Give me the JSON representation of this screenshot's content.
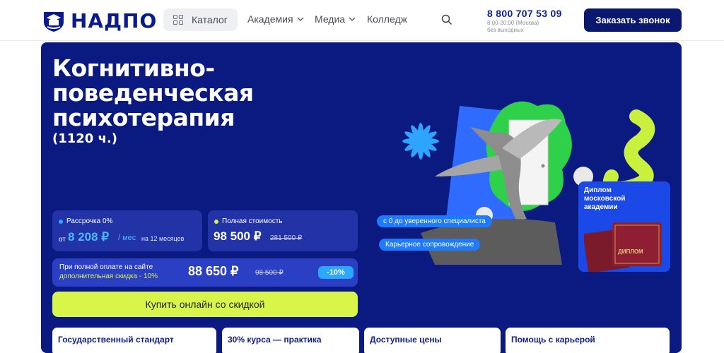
{
  "header": {
    "logo_text": "НАДПО",
    "catalog_label": "Каталог",
    "nav": [
      {
        "label": "Академия",
        "has_dropdown": true
      },
      {
        "label": "Медиа",
        "has_dropdown": true
      },
      {
        "label": "Колледж",
        "has_dropdown": false
      }
    ],
    "phone": "8 800 707 53 09",
    "hours_line1": "8:00-20:00 (Москва)",
    "hours_line2": "без выходных",
    "call_button": "Заказать звонок"
  },
  "hero": {
    "title": "Когнитивно-поведенческая психотерапия",
    "hours": "(1120 ч.)",
    "installment": {
      "label": "Рассрочка 0%",
      "prefix": "от",
      "amount": "8 208 ₽",
      "per": "/ мес",
      "term": "на 12 месяцев"
    },
    "full_price": {
      "label": "Полная стоимость",
      "amount": "98 500 ₽",
      "old_amount": "281 500 ₽"
    },
    "promo": {
      "line1": "При полной оплате на сайте",
      "line2": "дополнительная скидка - 10%",
      "amount": "88 650 ₽",
      "old_amount": "98 500 ₽",
      "badge": "-10%"
    },
    "buy_button": "Купить онлайн со скидкой",
    "illustration": {
      "pill1": "с 0 до уверенного специалиста",
      "pill2": "Карьерное сопровождение",
      "diploma_title": "Диплом московской академии",
      "diploma_cover": "ДИПЛОМ"
    },
    "features": [
      "Государственный стандарт",
      "30% курса — практика",
      "Доступные цены",
      "Помощь с карьерой"
    ]
  },
  "colors": {
    "brand_navy": "#0a1a80",
    "accent_lime": "#d8f54a",
    "accent_blue": "#2ba8ff"
  }
}
